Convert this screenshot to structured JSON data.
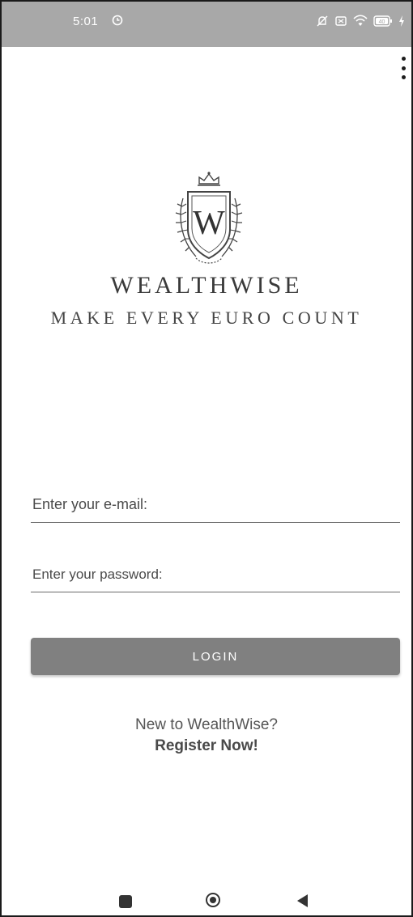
{
  "status_bar": {
    "time": "5:01",
    "icons": [
      "clock-icon",
      "muted-notification-icon",
      "screenshot-icon",
      "wifi-icon",
      "battery-icon"
    ],
    "battery_level": "40",
    "background": "#a8a8a8"
  },
  "toolbar": {
    "menu_icon": "overflow-menu-icon"
  },
  "brand": {
    "logo_letter": "W",
    "name": "WEALTHWISE",
    "tagline": "MAKE EVERY EURO COUNT"
  },
  "form": {
    "email_placeholder": "Enter your e-mail:",
    "email_value": "",
    "password_placeholder": "Enter your password:",
    "password_value": "",
    "login_label": "LOGIN"
  },
  "register": {
    "prompt": "New to WealthWise?",
    "link": "Register Now!"
  },
  "nav": {
    "icons": [
      "recents-icon",
      "home-icon",
      "back-icon"
    ]
  },
  "colors": {
    "accent_button": "#808080",
    "text_dark": "#333333"
  }
}
